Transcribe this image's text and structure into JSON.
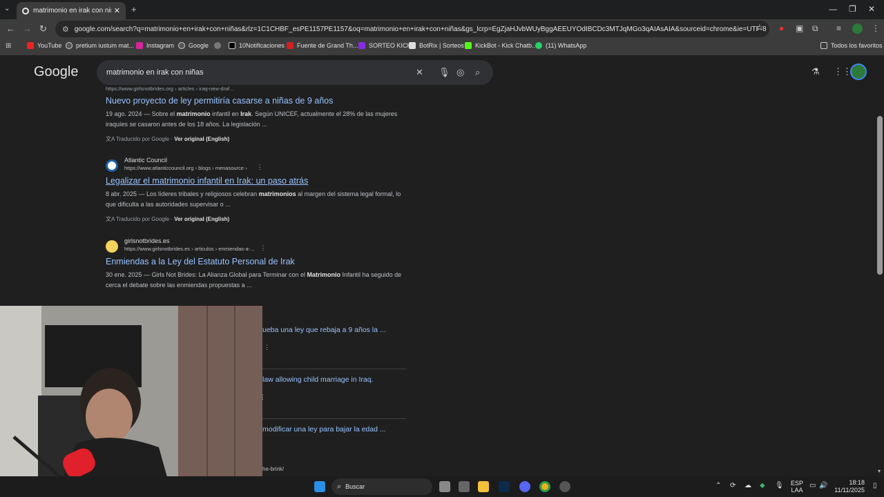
{
  "browser": {
    "tab_title": "matrimonio en irak con niñas ·",
    "url": "google.com/search?q=matrimonio+en+irak+con+niñas&rlz=1C1CHBF_esPE1157PE1157&oq=matrimonio+en+irak+con+niñas&gs_lcrp=EgZjaHJvbWUyBggAEEUYOdIBCDc3MTJqMGo3qAIAsAIA&sourceid=chrome&ie=UTF-8",
    "bookmarks": [
      "YouTube",
      "pretium iustum mat...",
      "Instagram",
      "Google",
      "",
      "10Notificaciones",
      "Fuente de Grand Th...",
      "SORTEO KICK",
      "BotRix | Sorteos",
      "KickBot - Kick Chatb...",
      "(11) WhatsApp"
    ],
    "all_bookmarks": "Todos los favoritos"
  },
  "search": {
    "logo": "Google",
    "query": "matrimonio en irak con niñas"
  },
  "results": [
    {
      "url": "https://www.girlsnotbrides.org › articles › iraq-new-draf...",
      "title": "Nuevo proyecto de ley permitiría casarse a niñas de 9 años",
      "date": "19 ago. 2024",
      "snippet_a": " — Sobre el ",
      "bold1": "matrimonio",
      "snippet_b": " infantil en ",
      "bold2": "Irak",
      "snippet_c": ". Según UNICEF, actualmente el 28% de las mujeres iraquíes se casaron antes de los 18 años. La legislación ...",
      "translated": "Traducido por Google ·",
      "original": "Ver original (English)"
    },
    {
      "site": "Atlantic Council",
      "url": "https://www.atlanticcouncil.org › blogs › menasource ›",
      "title": "Legalizar el matrimonio infantil en Irak: un paso atrás",
      "date": "8 abr. 2025",
      "snippet_a": " — Los líderes tribales y religiosos celebran ",
      "bold1": "matrimonios",
      "snippet_b": " al margen del sistema legal formal, lo que dificulta a las autoridades supervisar o ...",
      "translated": "Traducido por Google ·",
      "original": "Ver original (English)"
    },
    {
      "site": "girlsnotbrides.es",
      "url": "https://www.girlsnotbrides.es › articulos › enmiendas-a-...",
      "title": "Enmiendas a la Ley del Estatuto Personal de Irak",
      "date": "30 ene. 2025",
      "snippet_a": " — Girls Not Brides: La Alianza Global para Terminar con el ",
      "bold1": "Matrimonio",
      "snippet_b": " Infantil ha seguido de cerca el debate sobre las enmiendas propuestas a ..."
    }
  ],
  "partials": [
    "ueba una ley que rebaja a 9 años la ...",
    "law allowing child marriage in Iraq.",
    "modificar una ley para bajar la edad ...",
    "he-brink/"
  ],
  "taskbar": {
    "search": "Buscar",
    "lang1": "ESP",
    "lang2": "LAA",
    "time": "18:18",
    "date": "11/11/2025"
  }
}
